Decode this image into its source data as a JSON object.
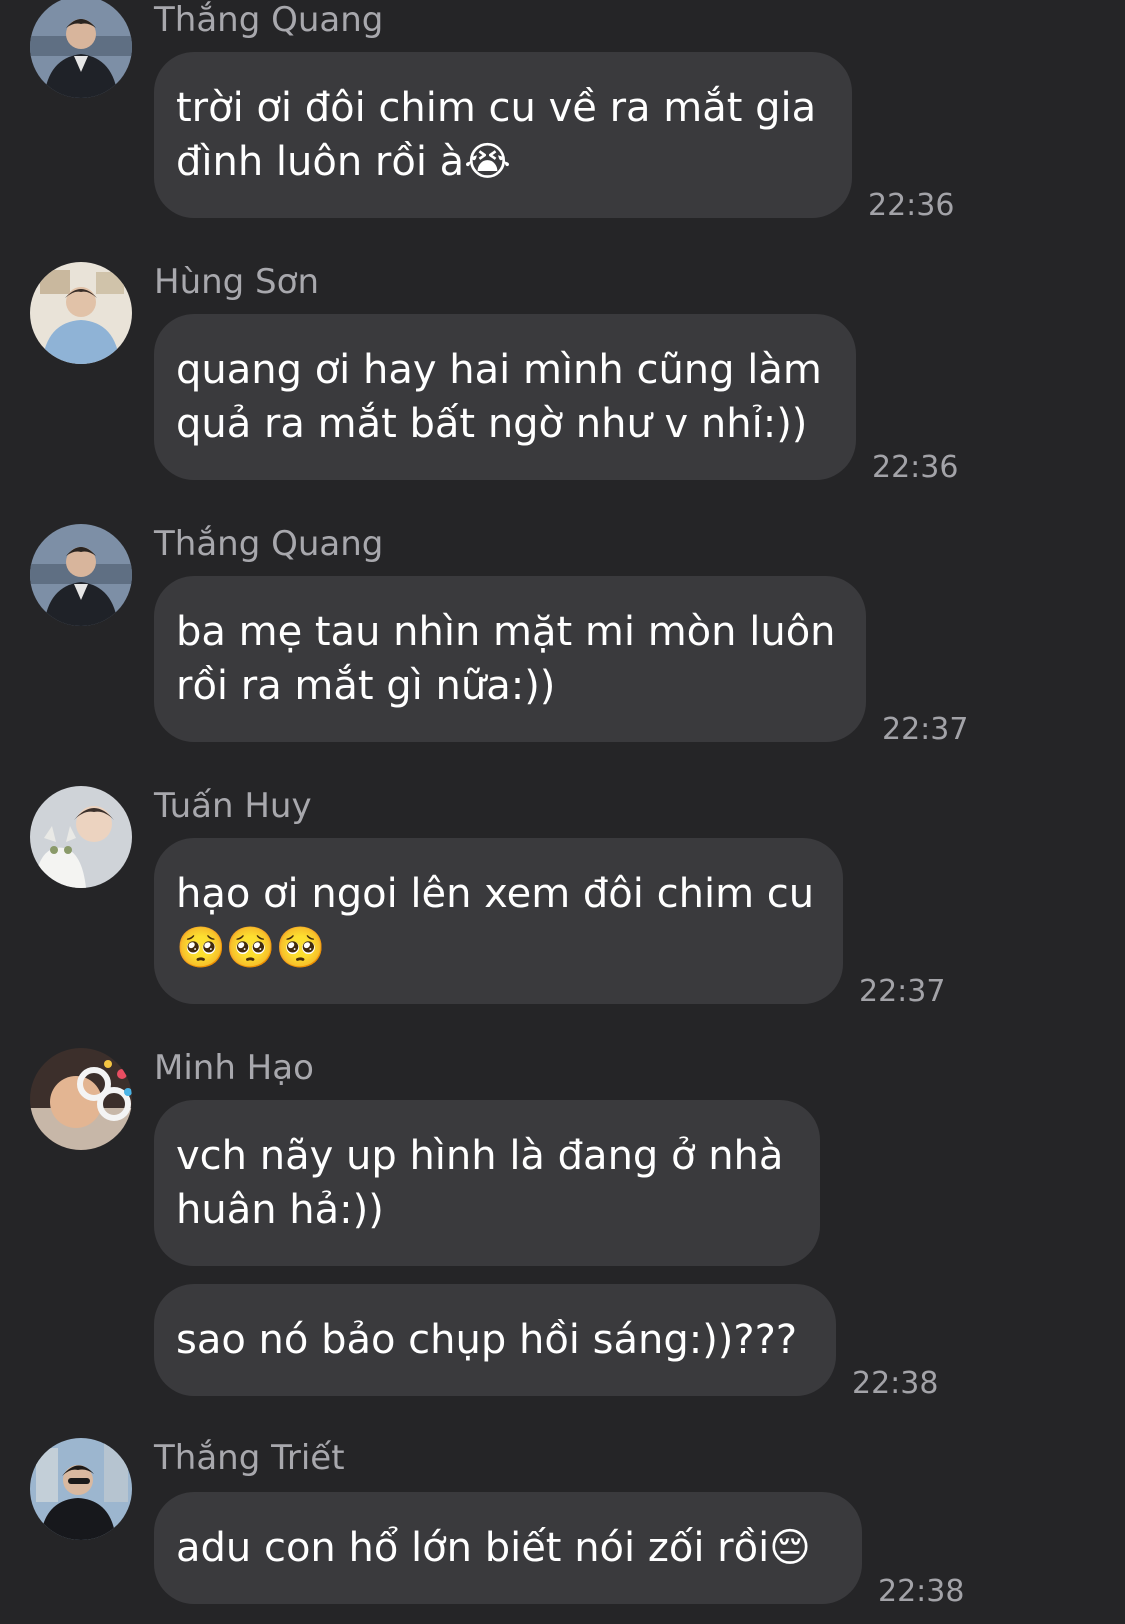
{
  "messages": [
    {
      "sender": "Thắng Quang",
      "bubbles": [
        "trời ơi đôi chim cu về ra mắt gia\nđình luôn rồi à😭"
      ],
      "time": "22:36",
      "avatar": "avatar-thang-quang"
    },
    {
      "sender": "Hùng Sơn",
      "bubbles": [
        "quang ơi hay hai mình cũng làm\nquả ra mắt bất ngờ như v nhỉ:))"
      ],
      "time": "22:36",
      "avatar": "avatar-hung-son"
    },
    {
      "sender": "Thắng Quang",
      "bubbles": [
        "ba mẹ tau nhìn mặt mi mòn luôn\nrồi ra mắt gì nữa:))"
      ],
      "time": "22:37",
      "avatar": "avatar-thang-quang"
    },
    {
      "sender": "Tuấn Huy",
      "bubbles": [
        "hạo ơi ngoi lên xem đôi chim cu\n🥺🥺🥺"
      ],
      "time": "22:37",
      "avatar": "avatar-tuan-huy"
    },
    {
      "sender": "Minh Hạo",
      "bubbles": [
        "vch nãy up hình là đang ở nhà\nhuân hả:))",
        "sao nó bảo chụp hồi sáng:))???"
      ],
      "time": "22:38",
      "avatar": "avatar-minh-hao"
    },
    {
      "sender": "Thắng Triết",
      "bubbles": [
        "adu con hổ lớn biết nói zối rồi😔"
      ],
      "time": "22:38",
      "avatar": "avatar-thang-triet"
    }
  ],
  "colors": {
    "background": "#252527",
    "bubble": "#3a3a3d",
    "sender": "#a8a8ad",
    "time": "#a3a3a8"
  }
}
